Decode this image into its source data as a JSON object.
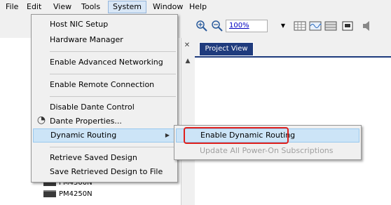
{
  "menubar": {
    "items": [
      "File",
      "Edit",
      "View",
      "Tools",
      "System",
      "Window",
      "Help"
    ],
    "active": "System"
  },
  "toolbar": {
    "zoom_value": "100%"
  },
  "project_view": {
    "tab_label": "Project View"
  },
  "tree": {
    "items": [
      "PM4500N",
      "PM4250N"
    ]
  },
  "system_menu": {
    "items": {
      "host_nic": "Host NIC Setup",
      "hardware_manager": "Hardware Manager",
      "enable_advanced_networking": "Enable Advanced Networking",
      "enable_remote_connection": "Enable Remote Connection",
      "disable_dante_control": "Disable Dante Control",
      "dante_properties": "Dante Properties...",
      "dynamic_routing": "Dynamic Routing",
      "retrieve_saved_design": "Retrieve Saved Design",
      "save_retrieved_design": "Save Retrieved Design to File"
    }
  },
  "dynamic_routing_submenu": {
    "enable": "Enable Dynamic Routing",
    "update": "Update All Power-On Subscriptions"
  },
  "colors": {
    "highlight": "#cce4f7",
    "callout": "#e0201c",
    "project_tab": "#1f3b7d"
  }
}
